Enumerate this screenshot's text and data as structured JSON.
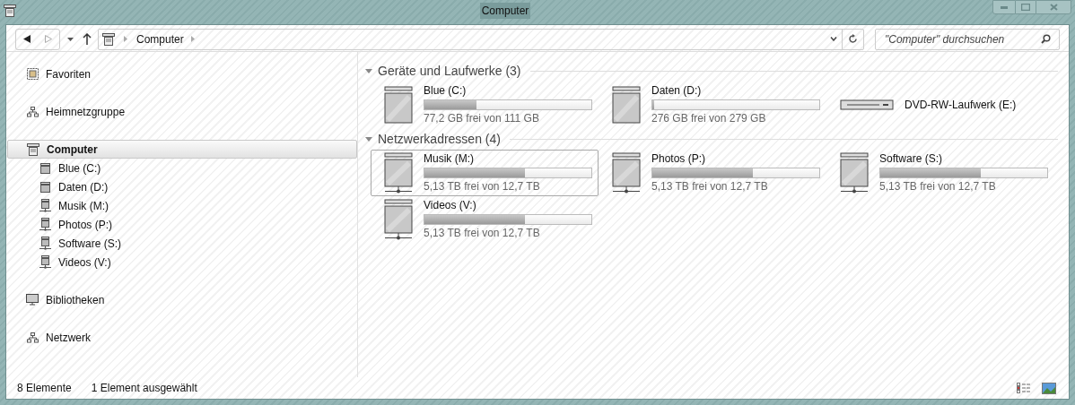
{
  "window": {
    "title": "Computer"
  },
  "address_bar": {
    "crumbs": [
      "Computer"
    ]
  },
  "search": {
    "placeholder": "\"Computer\" durchsuchen"
  },
  "sidebar": {
    "groups": [
      {
        "kind": "star",
        "label": "Favoriten",
        "selected": false
      },
      {
        "kind": "homegroup",
        "label": "Heimnetzgruppe",
        "selected": false
      },
      {
        "kind": "computer",
        "label": "Computer",
        "selected": true,
        "children": [
          {
            "kind": "disk",
            "label": "Blue (C:)",
            "selected": false
          },
          {
            "kind": "disk",
            "label": "Daten (D:)",
            "selected": false
          },
          {
            "kind": "network",
            "label": "Musik (M:)",
            "selected": false
          },
          {
            "kind": "network",
            "label": "Photos (P:)",
            "selected": false
          },
          {
            "kind": "network",
            "label": "Software (S:)",
            "selected": false
          },
          {
            "kind": "network",
            "label": "Videos (V:)",
            "selected": false
          }
        ]
      },
      {
        "kind": "library",
        "label": "Bibliotheken",
        "selected": false
      },
      {
        "kind": "homegroup",
        "label": "Netzwerk",
        "selected": false
      }
    ]
  },
  "sections": [
    {
      "title": "Geräte und Laufwerke (3)",
      "expanded": true,
      "items": [
        {
          "kind": "disk",
          "name": "Blue (C:)",
          "level": 0.31,
          "reading": "77,2 GB frei von 111 GB",
          "selected": false
        },
        {
          "kind": "disk",
          "name": "Daten (D:)",
          "level": 0.01,
          "reading": "276 GB frei von 279 GB",
          "selected": false
        },
        {
          "kind": "optical",
          "name": "DVD-RW-Laufwerk (E:)",
          "selected": false
        }
      ]
    },
    {
      "title": "Netzwerkadressen (4)",
      "expanded": true,
      "items": [
        {
          "kind": "network",
          "name": "Musik (M:)",
          "level": 0.6,
          "reading": "5,13 TB frei von 12,7 TB",
          "selected": true
        },
        {
          "kind": "network",
          "name": "Photos (P:)",
          "level": 0.6,
          "reading": "5,13 TB frei von 12,7 TB",
          "selected": false
        },
        {
          "kind": "network",
          "name": "Software (S:)",
          "level": 0.6,
          "reading": "5,13 TB frei von 12,7 TB",
          "selected": false
        },
        {
          "kind": "network",
          "name": "Videos (V:)",
          "level": 0.6,
          "reading": "5,13 TB frei von 12,7 TB",
          "selected": false
        }
      ]
    }
  ],
  "status_bar": {
    "items": [
      "8 Elemente",
      "1 Element ausgewählt"
    ]
  }
}
